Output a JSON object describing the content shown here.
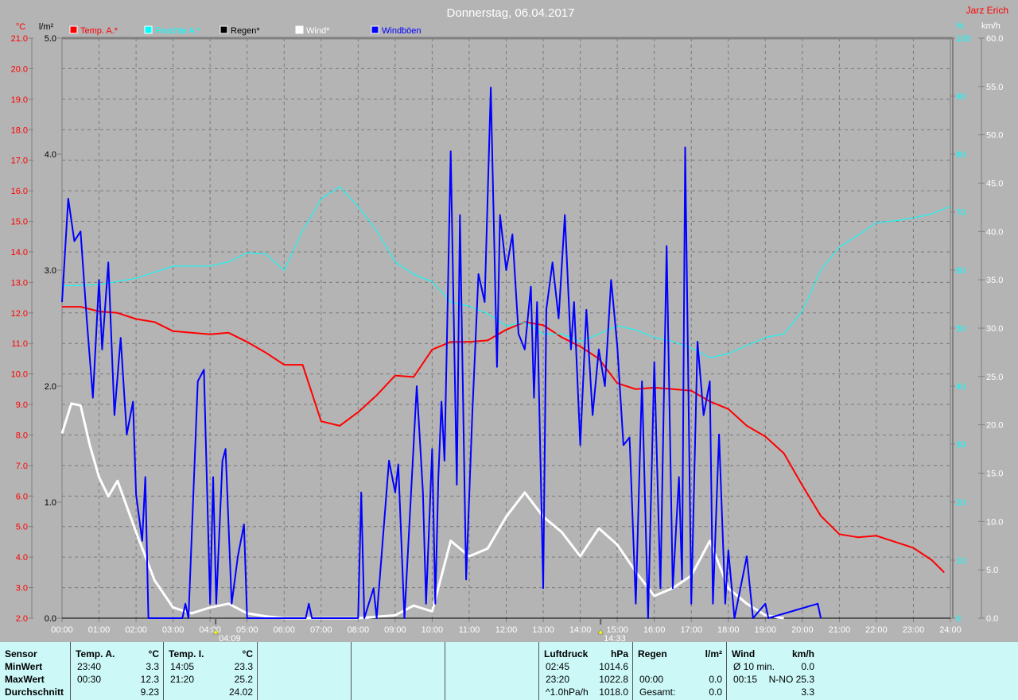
{
  "header": {
    "title": "Donnerstag, 06.04.2017",
    "author": "Jarz Erich"
  },
  "chart_data": {
    "type": "line",
    "title": "Donnerstag, 06.04.2017",
    "legend": [
      {
        "name": "Temp. A.*",
        "color": "#ff0000"
      },
      {
        "name": "Feuchte A.*",
        "color": "#00ffff"
      },
      {
        "name": "Regen*",
        "color": "#000000"
      },
      {
        "name": "Wind*",
        "color": "#ffffff"
      },
      {
        "name": "Windböen",
        "color": "#0000ff"
      }
    ],
    "legend_placement": "top-left",
    "grid": true,
    "x_ticks": [
      "00:00",
      "01:00",
      "02:00",
      "03:00",
      "04:00",
      "05:00",
      "06:00",
      "07:00",
      "08:00",
      "09:00",
      "10:00",
      "11:00",
      "12:00",
      "13:00",
      "14:00",
      "15:00",
      "16:00",
      "17:00",
      "18:00",
      "19:00",
      "20:00",
      "21:00",
      "22:00",
      "23:00",
      "24:00"
    ],
    "x_range_hours": [
      0,
      24
    ],
    "axes": {
      "temp": {
        "unit": "°C",
        "range": [
          2,
          21
        ],
        "ticks": [
          "2.0",
          "3.0",
          "4.0",
          "5.0",
          "6.0",
          "7.0",
          "8.0",
          "9.0",
          "10.0",
          "11.0",
          "12.0",
          "13.0",
          "14.0",
          "15.0",
          "16.0",
          "17.0",
          "18.0",
          "19.0",
          "20.0",
          "21.0"
        ],
        "color": "#ff0000"
      },
      "rain": {
        "unit": "l/m²",
        "range": [
          0,
          5
        ],
        "ticks": [
          "0.0",
          "1.0",
          "2.0",
          "3.0",
          "4.0",
          "5.0"
        ],
        "color": "#000000"
      },
      "humidity": {
        "unit": "%",
        "range": [
          0,
          100
        ],
        "ticks": [
          "0",
          "10",
          "20",
          "30",
          "40",
          "50",
          "60",
          "70",
          "80",
          "90",
          "100"
        ],
        "color": "#00ffff"
      },
      "wind": {
        "unit": "km/h",
        "range": [
          0,
          60
        ],
        "ticks": [
          "0.0",
          "5.0",
          "10.0",
          "15.0",
          "20.0",
          "25.0",
          "30.0",
          "35.0",
          "40.0",
          "45.0",
          "50.0",
          "55.0",
          "60.0"
        ],
        "color": "#ffffff"
      }
    },
    "markers": [
      {
        "label": "04:09",
        "time": "04:09",
        "kind": "sunrise"
      },
      {
        "label": "14:33",
        "time": "14:33",
        "kind": "moon"
      }
    ],
    "series": [
      {
        "name": "Temp. A.*",
        "axis": "temp",
        "color": "#ff0000",
        "width": 2,
        "points": [
          [
            "00:00",
            12.2
          ],
          [
            "00:30",
            12.2
          ],
          [
            "01:00",
            12.05
          ],
          [
            "01:30",
            12.0
          ],
          [
            "02:00",
            11.8
          ],
          [
            "02:30",
            11.7
          ],
          [
            "03:00",
            11.4
          ],
          [
            "03:30",
            11.35
          ],
          [
            "04:00",
            11.3
          ],
          [
            "04:30",
            11.35
          ],
          [
            "05:00",
            11.05
          ],
          [
            "05:30",
            10.7
          ],
          [
            "06:00",
            10.3
          ],
          [
            "06:30",
            10.3
          ],
          [
            "07:00",
            8.45
          ],
          [
            "07:30",
            8.3
          ],
          [
            "08:00",
            8.75
          ],
          [
            "08:30",
            9.3
          ],
          [
            "09:00",
            9.95
          ],
          [
            "09:30",
            9.9
          ],
          [
            "10:00",
            10.8
          ],
          [
            "10:30",
            11.05
          ],
          [
            "11:00",
            11.05
          ],
          [
            "11:30",
            11.1
          ],
          [
            "12:00",
            11.45
          ],
          [
            "12:30",
            11.7
          ],
          [
            "13:00",
            11.6
          ],
          [
            "13:30",
            11.2
          ],
          [
            "14:00",
            10.9
          ],
          [
            "14:30",
            10.5
          ],
          [
            "15:00",
            9.7
          ],
          [
            "15:30",
            9.5
          ],
          [
            "16:00",
            9.55
          ],
          [
            "16:30",
            9.5
          ],
          [
            "17:00",
            9.45
          ],
          [
            "17:30",
            9.1
          ],
          [
            "18:00",
            8.85
          ],
          [
            "18:30",
            8.3
          ],
          [
            "19:00",
            7.95
          ],
          [
            "19:30",
            7.4
          ],
          [
            "20:00",
            6.35
          ],
          [
            "20:30",
            5.35
          ],
          [
            "21:00",
            4.75
          ],
          [
            "21:30",
            4.65
          ],
          [
            "22:00",
            4.7
          ],
          [
            "22:30",
            4.5
          ],
          [
            "23:00",
            4.3
          ],
          [
            "23:30",
            3.9
          ],
          [
            "23:50",
            3.5
          ]
        ]
      },
      {
        "name": "Feuchte A.*",
        "axis": "humidity",
        "color": "#00ffff",
        "width": 1,
        "points": [
          [
            "00:00",
            57.3
          ],
          [
            "01:00",
            57.5
          ],
          [
            "02:00",
            58.6
          ],
          [
            "03:00",
            60.7
          ],
          [
            "04:00",
            60.7
          ],
          [
            "04:30",
            61.4
          ],
          [
            "05:00",
            63
          ],
          [
            "05:30",
            62.8
          ],
          [
            "06:00",
            60
          ],
          [
            "06:30",
            66.8
          ],
          [
            "07:00",
            72.3
          ],
          [
            "07:30",
            74.4
          ],
          [
            "08:00",
            71
          ],
          [
            "08:30",
            66.8
          ],
          [
            "09:00",
            61.4
          ],
          [
            "09:30",
            59.3
          ],
          [
            "10:00",
            58
          ],
          [
            "10:30",
            54.5
          ],
          [
            "11:00",
            53.8
          ],
          [
            "11:30",
            52.5
          ],
          [
            "12:00",
            50.4
          ],
          [
            "12:30",
            51
          ],
          [
            "13:00",
            49
          ],
          [
            "13:30",
            49
          ],
          [
            "14:00",
            47.7
          ],
          [
            "14:30",
            49
          ],
          [
            "15:00",
            50.4
          ],
          [
            "15:30",
            49.7
          ],
          [
            "16:00",
            48.4
          ],
          [
            "16:30",
            47.7
          ],
          [
            "17:00",
            46.6
          ],
          [
            "17:30",
            44.9
          ],
          [
            "18:00",
            45.6
          ],
          [
            "18:30",
            47
          ],
          [
            "19:00",
            48.4
          ],
          [
            "19:30",
            49
          ],
          [
            "20:00",
            53
          ],
          [
            "20:30",
            60
          ],
          [
            "21:00",
            64
          ],
          [
            "21:30",
            66
          ],
          [
            "22:00",
            68.2
          ],
          [
            "22:30",
            68.5
          ],
          [
            "23:00",
            69
          ],
          [
            "23:30",
            69.7
          ],
          [
            "24:00",
            71
          ]
        ]
      },
      {
        "name": "Regen*",
        "axis": "rain",
        "color": "#000000",
        "width": 1,
        "points": [
          [
            "00:00",
            0
          ],
          [
            "24:00",
            0
          ]
        ]
      },
      {
        "name": "Wind*",
        "axis": "wind",
        "color": "#ffffff",
        "width": 3,
        "points": [
          [
            "00:00",
            19.1
          ],
          [
            "00:15",
            22.2
          ],
          [
            "00:30",
            22
          ],
          [
            "00:45",
            17.9
          ],
          [
            "01:00",
            14.6
          ],
          [
            "01:15",
            12.6
          ],
          [
            "01:30",
            14.2
          ],
          [
            "02:00",
            8.9
          ],
          [
            "02:30",
            3.9
          ],
          [
            "03:00",
            1.1
          ],
          [
            "03:30",
            0.5
          ],
          [
            "04:00",
            1.1
          ],
          [
            "04:30",
            1.5
          ],
          [
            "05:00",
            0.5
          ],
          [
            "05:30",
            0.2
          ],
          [
            "06:00",
            0
          ],
          [
            "08:00",
            0
          ],
          [
            "09:00",
            0.3
          ],
          [
            "09:30",
            1.3
          ],
          [
            "10:00",
            0.7
          ],
          [
            "10:30",
            8
          ],
          [
            "11:00",
            6.4
          ],
          [
            "11:30",
            7.2
          ],
          [
            "12:00",
            10.5
          ],
          [
            "12:30",
            13
          ],
          [
            "13:00",
            10.5
          ],
          [
            "13:30",
            8.9
          ],
          [
            "14:00",
            6.4
          ],
          [
            "14:30",
            9.3
          ],
          [
            "15:00",
            7.6
          ],
          [
            "15:30",
            4.8
          ],
          [
            "16:00",
            2.3
          ],
          [
            "16:30",
            3.1
          ],
          [
            "17:00",
            4.4
          ],
          [
            "17:30",
            8
          ],
          [
            "18:00",
            3.1
          ],
          [
            "18:30",
            1.5
          ],
          [
            "19:00",
            0.3
          ],
          [
            "19:30",
            0
          ]
        ]
      },
      {
        "name": "Windböen",
        "axis": "wind",
        "color": "#0000ff",
        "width": 2,
        "points": [
          [
            "00:00",
            32.7
          ],
          [
            "00:10",
            43.4
          ],
          [
            "00:20",
            39
          ],
          [
            "00:30",
            40
          ],
          [
            "00:40",
            31
          ],
          [
            "00:50",
            22.8
          ],
          [
            "01:00",
            35
          ],
          [
            "01:05",
            27.8
          ],
          [
            "01:15",
            36.8
          ],
          [
            "01:25",
            21
          ],
          [
            "01:35",
            29
          ],
          [
            "01:45",
            19
          ],
          [
            "01:55",
            22.4
          ],
          [
            "02:00",
            12.8
          ],
          [
            "02:10",
            8
          ],
          [
            "02:15",
            14.6
          ],
          [
            "02:20",
            0
          ],
          [
            "03:15",
            0
          ],
          [
            "03:20",
            1.5
          ],
          [
            "03:25",
            0
          ],
          [
            "03:40",
            24.5
          ],
          [
            "03:50",
            25.7
          ],
          [
            "04:00",
            1.5
          ],
          [
            "04:05",
            14.6
          ],
          [
            "04:10",
            1.5
          ],
          [
            "04:20",
            16.3
          ],
          [
            "04:25",
            17.5
          ],
          [
            "04:35",
            1.5
          ],
          [
            "04:45",
            6.4
          ],
          [
            "04:55",
            9.7
          ],
          [
            "05:00",
            0
          ],
          [
            "06:35",
            0
          ],
          [
            "06:40",
            1.5
          ],
          [
            "06:45",
            0
          ],
          [
            "08:00",
            0
          ],
          [
            "08:05",
            13
          ],
          [
            "08:10",
            0
          ],
          [
            "08:25",
            3.1
          ],
          [
            "08:30",
            0
          ],
          [
            "08:50",
            16.3
          ],
          [
            "09:00",
            13
          ],
          [
            "09:05",
            15.9
          ],
          [
            "09:15",
            0
          ],
          [
            "09:35",
            24
          ],
          [
            "09:45",
            13
          ],
          [
            "09:50",
            1.5
          ],
          [
            "10:00",
            17.5
          ],
          [
            "10:05",
            1.5
          ],
          [
            "10:10",
            14.6
          ],
          [
            "10:15",
            22.4
          ],
          [
            "10:20",
            16.3
          ],
          [
            "10:30",
            48.3
          ],
          [
            "10:40",
            13.8
          ],
          [
            "10:45",
            41.7
          ],
          [
            "10:55",
            4
          ],
          [
            "11:05",
            21
          ],
          [
            "11:15",
            35.6
          ],
          [
            "11:25",
            32.7
          ],
          [
            "11:35",
            54.9
          ],
          [
            "11:45",
            26
          ],
          [
            "11:50",
            41.7
          ],
          [
            "12:00",
            36
          ],
          [
            "12:10",
            39.7
          ],
          [
            "12:20",
            29.4
          ],
          [
            "12:30",
            27.8
          ],
          [
            "12:40",
            34.3
          ],
          [
            "12:45",
            22.8
          ],
          [
            "12:50",
            32.7
          ],
          [
            "13:00",
            3.1
          ],
          [
            "13:05",
            31.9
          ],
          [
            "13:15",
            36.8
          ],
          [
            "13:25",
            31
          ],
          [
            "13:35",
            41.7
          ],
          [
            "13:45",
            27.8
          ],
          [
            "13:50",
            32.7
          ],
          [
            "14:00",
            17.9
          ],
          [
            "14:10",
            31.9
          ],
          [
            "14:20",
            21
          ],
          [
            "14:30",
            27.8
          ],
          [
            "14:40",
            24
          ],
          [
            "14:50",
            35
          ],
          [
            "15:00",
            28.2
          ],
          [
            "15:10",
            17.9
          ],
          [
            "15:20",
            18.7
          ],
          [
            "15:30",
            1.5
          ],
          [
            "15:40",
            24.5
          ],
          [
            "15:50",
            0
          ],
          [
            "16:00",
            26.5
          ],
          [
            "16:10",
            3.1
          ],
          [
            "16:20",
            38.5
          ],
          [
            "16:30",
            3.1
          ],
          [
            "16:40",
            14.6
          ],
          [
            "16:45",
            4
          ],
          [
            "16:50",
            48.7
          ],
          [
            "17:00",
            1.5
          ],
          [
            "17:10",
            28.6
          ],
          [
            "17:20",
            21
          ],
          [
            "17:30",
            24.5
          ],
          [
            "17:35",
            1.5
          ],
          [
            "17:45",
            19
          ],
          [
            "17:55",
            1.5
          ],
          [
            "18:00",
            7
          ],
          [
            "18:10",
            0
          ],
          [
            "18:30",
            6.4
          ],
          [
            "18:40",
            0
          ],
          [
            "19:00",
            1.5
          ],
          [
            "19:05",
            0
          ],
          [
            "20:25",
            1.5
          ],
          [
            "20:30",
            0
          ]
        ]
      }
    ]
  },
  "table": {
    "sensor_col": {
      "header": "Sensor",
      "rows": [
        "MinWert",
        "MaxWert",
        "Durchschnitt"
      ]
    },
    "temp_a": {
      "header": "Temp. A.",
      "unit": "°C",
      "times": [
        "23:40",
        "00:30",
        ""
      ],
      "values": [
        "3.3",
        "12.3",
        "9.23"
      ]
    },
    "temp_i": {
      "header": "Temp. I.",
      "unit": "°C",
      "times": [
        "14:05",
        "21:20",
        ""
      ],
      "values": [
        "23.3",
        "25.2",
        "24.02"
      ]
    },
    "luftdruck": {
      "header": "Luftdruck",
      "unit": "hPa",
      "times": [
        "02:45",
        "23:20",
        "^1.0hPa/h"
      ],
      "values": [
        "1014.6",
        "1022.8",
        "1018.0"
      ]
    },
    "regen": {
      "header": "Regen",
      "unit": "l/m²",
      "times": [
        "",
        "00:00",
        "Gesamt:"
      ],
      "values": [
        "",
        "0.0",
        "0.0"
      ]
    },
    "wind": {
      "header": "Wind",
      "unit": "km/h",
      "times": [
        "Ø 10 min.",
        "00:15",
        ""
      ],
      "values": [
        "0.0",
        "N-NO 25.3",
        "3.3"
      ]
    }
  }
}
